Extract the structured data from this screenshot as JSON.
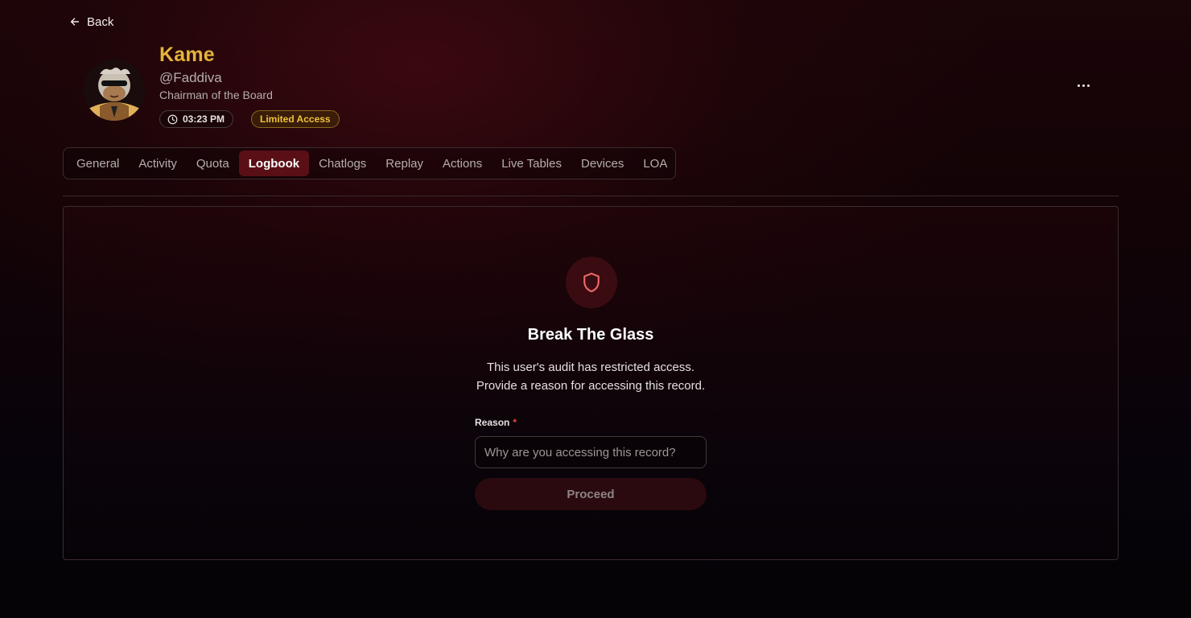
{
  "nav": {
    "back_label": "Back"
  },
  "profile": {
    "display_name": "Kame",
    "username": "@Faddiva",
    "role": "Chairman of the Board",
    "local_time": "03:23 PM",
    "access_badge": "Limited Access"
  },
  "tabs": [
    {
      "label": "General",
      "active": false
    },
    {
      "label": "Activity",
      "active": false
    },
    {
      "label": "Quota",
      "active": false
    },
    {
      "label": "Logbook",
      "active": true
    },
    {
      "label": "Chatlogs",
      "active": false
    },
    {
      "label": "Replay",
      "active": false
    },
    {
      "label": "Actions",
      "active": false
    },
    {
      "label": "Live Tables",
      "active": false
    },
    {
      "label": "Devices",
      "active": false
    },
    {
      "label": "LOA",
      "active": false
    }
  ],
  "gate": {
    "icon": "shield-icon",
    "title": "Break The Glass",
    "description_line1": "This user's audit has restricted access.",
    "description_line2": "Provide a reason for accessing this record.",
    "reason_label": "Reason",
    "required_marker": "*",
    "reason_value": "",
    "reason_placeholder": "Why are you accessing this record?",
    "proceed_label": "Proceed"
  },
  "colors": {
    "accent": "#5a0f16",
    "name_gold": "#e4b43a",
    "badge_gold": "#efc23a",
    "shield_red": "#f06a6a"
  }
}
